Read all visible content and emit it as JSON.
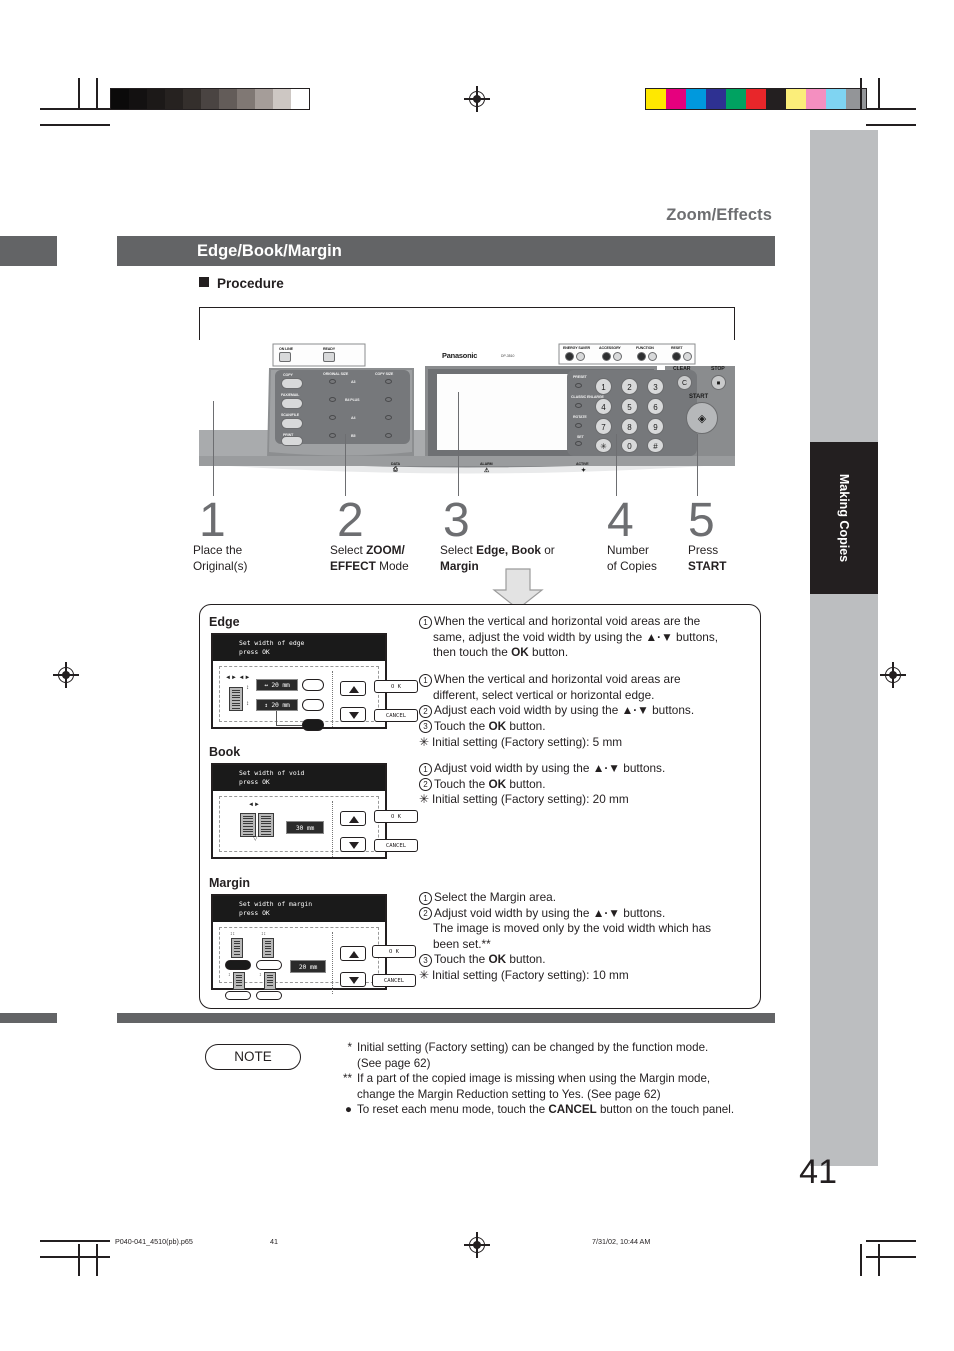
{
  "page": {
    "running_head": "Zoom/Effects",
    "section_title": "Edge/Book/Margin",
    "procedure_label": "Procedure",
    "folio": "41",
    "side_tab": "Making Copies"
  },
  "steps": [
    {
      "num": "1",
      "line1": "Place the",
      "line1b": "",
      "line2": "Original(s)",
      "bold1": "",
      "bold2": ""
    },
    {
      "num": "2",
      "line1": "Select ",
      "bold1": "ZOOM/",
      "line2_bold": "EFFECT",
      "line2": " Mode"
    },
    {
      "num": "3",
      "line1": "Select ",
      "bold1": "Edge, Book",
      "line1c": " or",
      "line2_bold": "Margin",
      "line2": ""
    },
    {
      "num": "4",
      "line1": "Number",
      "line2": "of Copies"
    },
    {
      "num": "5",
      "line1": "Press",
      "line2_bold": "START"
    }
  ],
  "step_text": {
    "s1a": "Place the",
    "s1b": "Original(s)",
    "s2a_pre": "Select ",
    "s2a_bold": "ZOOM/",
    "s2b_bold": "EFFECT",
    "s2b_post": " Mode",
    "s3a_pre": "Select ",
    "s3a_bold": "Edge, Book",
    "s3a_post": " or",
    "s3b_bold": "Margin",
    "s4a": "Number",
    "s4b": "of Copies",
    "s5a": "Press",
    "s5b_bold": "START"
  },
  "groups": {
    "edge": {
      "title": "Edge",
      "lcd": {
        "head_line1": "Set width of edge",
        "head_line2": "press OK",
        "value_h": "20 mm",
        "value_v": "20 mm",
        "ok": "O K",
        "cancel": "CANCEL"
      },
      "instructions": [
        {
          "marker": "1",
          "text_pre": "When the vertical and horizontal void areas are the"
        },
        {
          "marker": "",
          "text_pre": "same, adjust the void width by using the ▲·▼ buttons,"
        },
        {
          "marker": "",
          "text_pre": "then touch the ",
          "bold": "OK",
          "text_post": " button."
        }
      ],
      "lines": [
        "When the vertical and horizontal void areas are the",
        "same, adjust the void width by using the ▲·▼ buttons,",
        "then touch the OK button.",
        "When the vertical and horizontal void areas are",
        "different, select vertical or horizontal edge.",
        "Adjust each void width by using the ▲·▼ buttons.",
        "Touch the OK button.",
        "Initial setting (Factory setting): 5 mm"
      ]
    },
    "book": {
      "title": "Book",
      "lcd": {
        "head_line1": "Set width of void",
        "head_line2": "press OK",
        "value": "30 mm",
        "ok": "O K",
        "cancel": "CANCEL"
      },
      "lines": [
        "Adjust void width by using the ▲·▼ buttons.",
        "Touch the OK button.",
        "Initial setting (Factory setting): 20 mm"
      ]
    },
    "margin": {
      "title": "Margin",
      "lcd": {
        "head_line1": "Set width of margin",
        "head_line2": "press OK",
        "value": "20 mm",
        "ok": "O K",
        "cancel": "CANCEL"
      },
      "lines": [
        "Select the Margin area.",
        "Adjust void width by using the ▲·▼ buttons.",
        "The image is moved only by the void width which has",
        "been set.**",
        "Touch the OK button.",
        "Initial setting (Factory setting): 10 mm"
      ]
    }
  },
  "instructions_text": {
    "edge_1_1": "When the vertical and horizontal void areas are the",
    "edge_1_2_a": "same, adjust the void width by using the ",
    "edge_1_2_b": " buttons,",
    "edge_1_3_a": "then touch the ",
    "edge_1_3_bold": "OK",
    "edge_1_3_b": " button.",
    "edge_2_1": "When the vertical and horizontal void areas are",
    "edge_2_2": "different, select vertical or horizontal edge.",
    "edge_3_a": "Adjust each void width by using the ",
    "edge_3_b": " buttons.",
    "edge_4_a": "Touch the ",
    "edge_4_bold": "OK",
    "edge_4_b": " button.",
    "edge_5": "Initial setting (Factory setting): 5 mm",
    "book_1_a": "Adjust void width by using the ",
    "book_1_b": " buttons.",
    "book_2_a": "Touch the ",
    "book_2_bold": "OK",
    "book_2_b": " button.",
    "book_3": "Initial setting (Factory setting): 20 mm",
    "margin_1": "Select the Margin area.",
    "margin_2_a": "Adjust void width by using the ",
    "margin_2_b": " buttons.",
    "margin_2_c": "The image is moved only by the void width which has",
    "margin_2_d": "been set.**",
    "margin_3_a": "Touch the ",
    "margin_3_bold": "OK",
    "margin_3_b": " button.",
    "margin_4": "Initial setting (Factory setting): 10 mm",
    "arrows_glyph": "▲·▼"
  },
  "note": {
    "label": "NOTE",
    "items": [
      {
        "marker": "*",
        "line1": "Initial setting (Factory setting) can be changed by the function mode.",
        "line2": "(See page 62)"
      },
      {
        "marker": "**",
        "line1": "If a part of the copied image is missing when using the Margin mode,",
        "line2": "change the Margin Reduction setting to Yes. (See page 62)"
      },
      {
        "marker": "●",
        "line1_pre": "To reset each menu mode, touch the ",
        "bold": "CANCEL",
        "line1_post": " button on the touch panel."
      }
    ],
    "note_1_m": "*",
    "note_1_a": "Initial setting (Factory setting) can be changed by the function mode.",
    "note_1_b": "(See page 62)",
    "note_2_m": "**",
    "note_2_a": "If a part of the copied image is missing when using the Margin mode,",
    "note_2_b": "change the Margin Reduction setting to Yes. (See page 62)",
    "note_3_m": "●",
    "note_3_a": "To reset each menu mode, touch the ",
    "note_3_bold": "CANCEL",
    "note_3_b": " button on the touch panel."
  },
  "control_panel": {
    "brand": "Panasonic",
    "model": "DP-3510",
    "left_keys": [
      {
        "label": "COPY"
      },
      {
        "label": "FAX/EMAIL"
      },
      {
        "label": "SCAN/FILE"
      },
      {
        "label": "PRINT"
      }
    ],
    "size_header_left": "ORIGINAL SIZE",
    "size_header_right": "COPY SIZE",
    "size_rows": [
      "A3",
      "B4 PLUS",
      "A4",
      "B5"
    ],
    "top_left_icons": [
      "ON LINE",
      "READY"
    ],
    "status_row": [
      "ENERGY SAVER",
      "ACCESSORY",
      "FUNCTION",
      "RESET"
    ],
    "clear_label": "CLEAR",
    "clear_key": "C",
    "stop_label": "STOP",
    "start_label": "START",
    "keypad": [
      "1",
      "2",
      "3",
      "4",
      "5",
      "6",
      "7",
      "8",
      "9",
      "*",
      "0",
      "#"
    ],
    "side_leds": [
      "PRESET",
      "CLASSIC ENLARGE",
      "ROTATE",
      "SET"
    ],
    "indicators": [
      "DATA",
      "ALARM",
      "ACTIVE"
    ]
  },
  "print_marks": {
    "gray_patches": [
      "#0b0a0a",
      "#131111",
      "#1c1918",
      "#262220",
      "#342f2c",
      "#4a4442",
      "#635c59",
      "#807874",
      "#a59d99",
      "#cdc7c3",
      "#ffffff"
    ],
    "color_patches": [
      "#ffe800",
      "#e6007e",
      "#0099dd",
      "#2e3192",
      "#00a261",
      "#e8262a",
      "#231f20",
      "#fbee7a",
      "#f versus",
      "#7fd4f2",
      "#939598"
    ],
    "color_patches_fixed": [
      "#ffe800",
      "#e6007e",
      "#0099dd",
      "#2e3192",
      "#00a261",
      "#e8262a",
      "#231f20",
      "#fbee7a",
      "#f48fc0",
      "#7fd4f2",
      "#939598"
    ]
  },
  "footer": {
    "filename": "P040-041_4510(pb).p65",
    "page": "41",
    "timestamp": "7/31/02, 10:44 AM"
  }
}
